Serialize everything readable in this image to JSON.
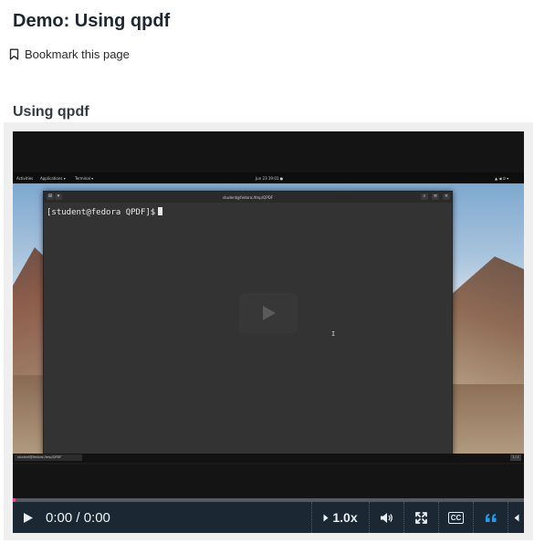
{
  "page": {
    "title": "Demo: Using qpdf",
    "bookmark_label": "Bookmark this page",
    "section_title": "Using qpdf"
  },
  "video": {
    "gnome_bar": {
      "activities": "Activities",
      "applications": "Applications ▾",
      "terminal": "Terminal ▾",
      "clock": "Jun 23  19:01 ●"
    },
    "terminal_window": {
      "title": "student@fedora:/tmp/QPDF",
      "prompt": "[student@fedora QPDF]$"
    },
    "taskbar": {
      "item": "student@fedora:/tmp/QPDF",
      "badge": "1 / 2"
    },
    "progress_fraction": 0.0,
    "accent_color": "#d94b8a",
    "controls": {
      "time": "0:00 / 0:00",
      "speed": "1.0x",
      "cc_label": "CC",
      "play_icon": "play-icon",
      "volume_icon": "volume-icon",
      "fullscreen_icon": "fullscreen-icon",
      "transcript_icon": "quote-icon",
      "more_icon": "caret-left-icon",
      "transcript_color": "#1e9cf0"
    }
  }
}
